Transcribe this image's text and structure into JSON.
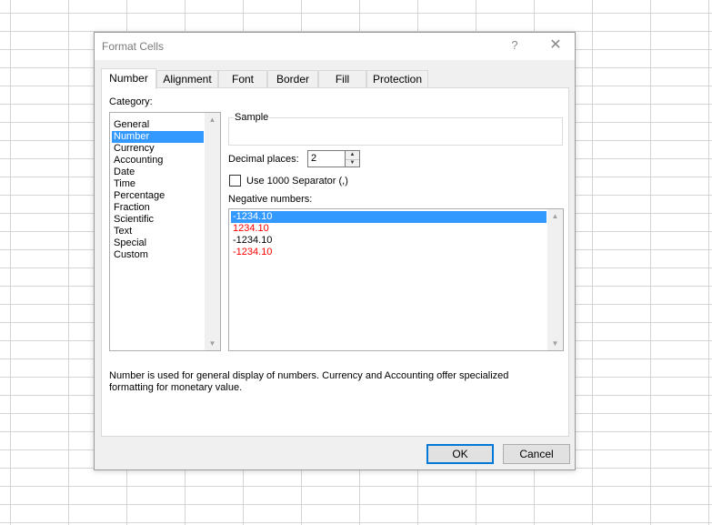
{
  "dialog": {
    "title": "Format Cells",
    "help_glyph": "?",
    "close_glyph": "✕"
  },
  "tabs": [
    {
      "label": "Number",
      "active": true
    },
    {
      "label": "Alignment",
      "active": false
    },
    {
      "label": "Font",
      "active": false
    },
    {
      "label": "Border",
      "active": false
    },
    {
      "label": "Fill",
      "active": false
    },
    {
      "label": "Protection",
      "active": false
    }
  ],
  "category": {
    "label": "Category:",
    "items": [
      "General",
      "Number",
      "Currency",
      "Accounting",
      "Date",
      "Time",
      "Percentage",
      "Fraction",
      "Scientific",
      "Text",
      "Special",
      "Custom"
    ],
    "selected": "Number"
  },
  "sample": {
    "label": "Sample",
    "value": ""
  },
  "decimal_places": {
    "label": "Decimal places:",
    "value": "2"
  },
  "separator": {
    "label": "Use 1000 Separator (,)",
    "checked": false
  },
  "negative_numbers": {
    "label": "Negative numbers:",
    "items": [
      {
        "text": "-1234.10",
        "color": "#000000",
        "selected": true
      },
      {
        "text": "1234.10",
        "color": "#ff0000",
        "selected": false
      },
      {
        "text": "-1234.10",
        "color": "#000000",
        "selected": false
      },
      {
        "text": "-1234.10",
        "color": "#ff0000",
        "selected": false
      }
    ]
  },
  "description": {
    "line1": "Number is used for general display of numbers.  Currency and Accounting offer specialized",
    "line2": "formatting for monetary value."
  },
  "buttons": {
    "ok": "OK",
    "cancel": "Cancel"
  },
  "colors": {
    "accent": "#0078d7",
    "selection": "#3399ff",
    "negative_red": "#ff0000"
  }
}
